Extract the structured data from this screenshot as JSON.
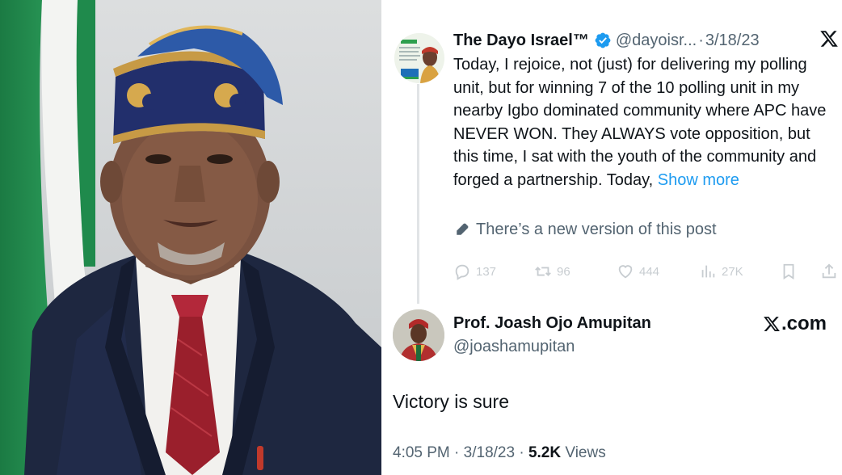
{
  "photo": {
    "alt": "Portrait of a man wearing a blue and gold cap, dark suit and red patterned tie in front of a green-white-green flag"
  },
  "tweet": {
    "author": {
      "name": "The Dayo Israel™",
      "handle": "@dayoisr...",
      "separator": "·",
      "date": "3/18/23",
      "verified": true,
      "avatar_icon": "profile-avatar"
    },
    "body": "Today, I rejoice, not (just) for delivering my polling unit, but for winning 7 of the 10 polling unit in my nearby Igbo dominated community where APC have NEVER WON. They ALWAYS vote opposition, but this time, I sat with the youth of the community and forged a partnership. Today, ",
    "show_more_label": "Show more",
    "new_version_notice": "There’s a new version of this post",
    "actions": {
      "replies": "137",
      "reposts": "96",
      "likes": "444",
      "views": "27K"
    }
  },
  "reply": {
    "author": {
      "name": "Prof. Joash Ojo Amupitan",
      "handle": "@joashamupitan"
    },
    "brand_suffix": ".com",
    "text": "Victory is sure",
    "time": "4:05 PM",
    "date": "3/18/23",
    "dot": "·",
    "views_count": "5.2K",
    "views_label": "Views"
  },
  "colors": {
    "link": "#1d9bf0",
    "secondary_text": "#536471",
    "primary_text": "#0f1419",
    "flag_green": "#1f8a4c"
  }
}
